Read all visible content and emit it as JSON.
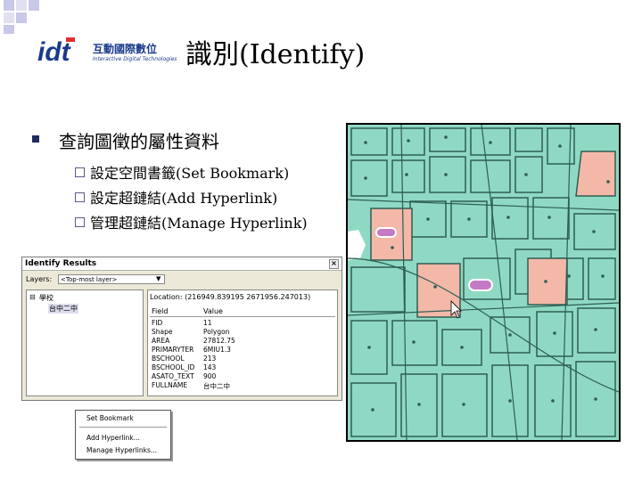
{
  "slide": {
    "title": "識別(Identify)",
    "logo_text": "互動國際數位",
    "logo_subtext": "Interactive Digital Technologies",
    "main_bullet": "查詢圖徵的屬性資料",
    "sub_bullets": [
      "設定空間書籤(Set Bookmark)",
      "設定超鏈結(Add Hyperlink)",
      "管理超鏈結(Manage Hyperlink)"
    ]
  },
  "identify_window": {
    "title": "Identify Results",
    "layers_label": "Layers:",
    "layers_value": "<Top-most layer>",
    "tree_root": "學校",
    "tree_child": "台中二中",
    "location": "Location: (216949.839195 2671956.247013)",
    "columns": [
      "Field",
      "Value"
    ],
    "rows": [
      {
        "field": "FID",
        "value": "11"
      },
      {
        "field": "Shape",
        "value": "Polygon"
      },
      {
        "field": "AREA",
        "value": "27812.75"
      },
      {
        "field": "PRIMARYTER",
        "value": "6MIU1.3"
      },
      {
        "field": "BSCHOOL",
        "value": "213"
      },
      {
        "field": "BSCHOOL_ID",
        "value": "143"
      },
      {
        "field": "ASATO_TEXT",
        "value": "900"
      },
      {
        "field": "FULLNAME",
        "value": "台中二中"
      }
    ]
  },
  "context_menu": {
    "items": [
      "Set Bookmark",
      "Add Hyperlink...",
      "Manage Hyperlinks..."
    ]
  },
  "colors": {
    "map_background": "#8fd9c4",
    "map_school": "#f4b8a8",
    "map_road": "#2e5e52",
    "bullet": "#1f2b5c"
  }
}
